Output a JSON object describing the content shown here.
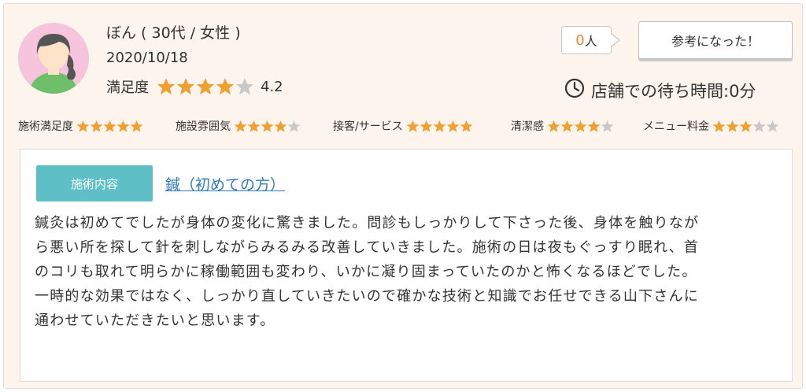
{
  "reviewer": {
    "name": "ぼん ( 30代 / 女性 )",
    "date": "2020/10/18",
    "avatar_icon": "female-avatar-icon"
  },
  "satisfaction": {
    "label": "満足度",
    "rating": 4.2,
    "score_text": "4.2",
    "stars_filled": 4,
    "stars_total": 5
  },
  "helpful": {
    "count": "0",
    "unit": "人",
    "button_label": "参考になった！"
  },
  "wait_time": {
    "icon": "clock-icon",
    "text": "店舗での待ち時間:0分"
  },
  "sub_ratings": [
    {
      "label": "施術満足度",
      "filled": 5
    },
    {
      "label": "施設雰囲気",
      "filled": 4
    },
    {
      "label": "接客/サービス",
      "filled": 5
    },
    {
      "label": "清潔感",
      "filled": 4
    },
    {
      "label": "メニュー料金",
      "filled": 3
    }
  ],
  "content": {
    "tag_label": "施術内容",
    "treatment_link": "鍼（初めての方）",
    "lines": [
      "鍼灸は初めてでしたが身体の変化に驚きました。問診もしっかりして下さった後、身体を触りなが",
      "ら悪い所を探して針を刺しながらみるみる改善していきました。施術の日は夜もぐっすり眠れ、首",
      "のコリも取れて明らかに稼働範囲も変わり、いかに凝り固まっていたのかと怖くなるほどでした。",
      "一時的な効果ではなく、しっかり直していきたいので確かな技術と知識でお任せできる山下さんに",
      "通わせていただきたいと思います。"
    ]
  },
  "colors": {
    "card_bg": "#fdf4ee",
    "star_filled": "#f0a030",
    "star_empty": "#c8c8c8",
    "tag_bg": "#5ebfc6",
    "link": "#2f7bbd",
    "count_accent": "#e88a2e",
    "avatar_bg": "#f6c4dc"
  }
}
